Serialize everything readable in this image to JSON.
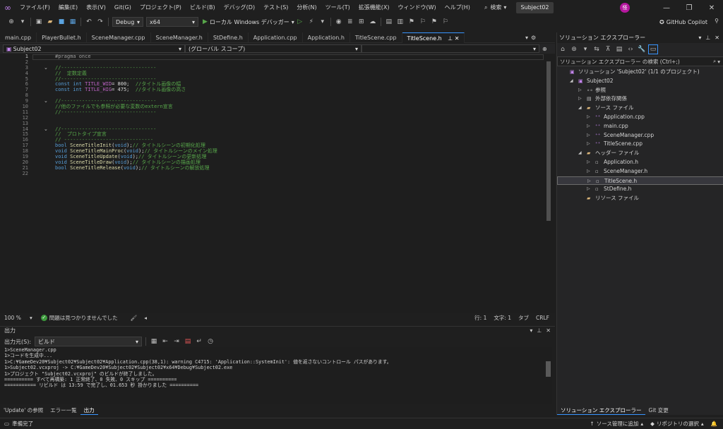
{
  "menu": {
    "items": [
      "ファイル(F)",
      "編集(E)",
      "表示(V)",
      "Git(G)",
      "プロジェクト(P)",
      "ビルド(B)",
      "デバッグ(D)",
      "テスト(S)",
      "分析(N)",
      "ツール(T)",
      "拡張機能(X)",
      "ウィンドウ(W)",
      "ヘルプ(H)"
    ],
    "search_label": "検索",
    "solution_name": "Subject02",
    "avatar_initial": "怪"
  },
  "toolbar": {
    "config": "Debug",
    "platform": "x64",
    "run_label": "ローカル Windows デバッガー",
    "copilot_label": "GitHub Copilot"
  },
  "tabs": [
    {
      "label": "main.cpp",
      "active": false
    },
    {
      "label": "PlayerBullet.h",
      "active": false
    },
    {
      "label": "SceneManager.cpp",
      "active": false
    },
    {
      "label": "SceneManager.h",
      "active": false
    },
    {
      "label": "StDefine.h",
      "active": false
    },
    {
      "label": "Application.cpp",
      "active": false
    },
    {
      "label": "Application.h",
      "active": false
    },
    {
      "label": "TitleScene.cpp",
      "active": false
    },
    {
      "label": "TitleScene.h",
      "active": true
    }
  ],
  "navbar": {
    "project": "Subject02",
    "scope": "(グローバル スコープ)"
  },
  "editor": {
    "line_numbers": [
      "1",
      "2",
      "3",
      "4",
      "5",
      "6",
      "7",
      "8",
      "9",
      "10",
      "11",
      "12",
      "13",
      "14",
      "15",
      "16",
      "17",
      "18",
      "19",
      "20",
      "21",
      "22"
    ],
    "lines": [
      [
        [
          "pp",
          "#pragma once"
        ]
      ],
      [],
      [
        [
          "cm",
          "//--------------------------------"
        ]
      ],
      [
        [
          "cm",
          "//  定数定義"
        ]
      ],
      [
        [
          "cm",
          "//--------------------------------"
        ]
      ],
      [
        [
          "kw",
          "const int "
        ],
        [
          "id",
          "TITLE_WID"
        ],
        [
          "",
          "= 800;  "
        ],
        [
          "cm",
          "//タイトル画像の幅"
        ]
      ],
      [
        [
          "kw",
          "const int "
        ],
        [
          "id",
          "TITLE_HIG"
        ],
        [
          "",
          "= 475;  "
        ],
        [
          "cm",
          "//タイトル画像の高さ"
        ]
      ],
      [],
      [
        [
          "cm",
          "//--------------------------------"
        ]
      ],
      [
        [
          "cm",
          "//他のファイルでも参照が必要な変数のextern宣言"
        ]
      ],
      [
        [
          "cm",
          "//--------------------------------"
        ]
      ],
      [],
      [],
      [
        [
          "cm",
          "//--------------------------------"
        ]
      ],
      [
        [
          "cm",
          "//  プロトタイプ宣言"
        ]
      ],
      [
        [
          "cm",
          "// ------------------------------"
        ]
      ],
      [
        [
          "kw",
          "bool "
        ],
        [
          "fn",
          "SceneTitleInit"
        ],
        [
          "",
          "("
        ],
        [
          "kw",
          "void"
        ],
        [
          "",
          ");"
        ],
        [
          "cm",
          "// タイトルシーンの初期化処理"
        ]
      ],
      [
        [
          "kw",
          "void "
        ],
        [
          "fn",
          "SceneTitleMainProc"
        ],
        [
          "",
          "("
        ],
        [
          "kw",
          "void"
        ],
        [
          "",
          ");"
        ],
        [
          "cm",
          "// タイトルシーンのメイン処理"
        ]
      ],
      [
        [
          "kw",
          "void "
        ],
        [
          "fn",
          "SceneTitleUpdate"
        ],
        [
          "",
          "("
        ],
        [
          "kw",
          "void"
        ],
        [
          "",
          ");"
        ],
        [
          "cm",
          "// タイトルシーンの更新処理"
        ]
      ],
      [
        [
          "kw",
          "void "
        ],
        [
          "fn",
          "SceneTitleDraw"
        ],
        [
          "",
          "("
        ],
        [
          "kw",
          "void"
        ],
        [
          "",
          ");"
        ],
        [
          "cm",
          "// タイトルシーンの描画処理"
        ]
      ],
      [
        [
          "kw",
          "bool "
        ],
        [
          "fn",
          "SceneTitleRelease"
        ],
        [
          "",
          "("
        ],
        [
          "kw",
          "void"
        ],
        [
          "",
          ");"
        ],
        [
          "cm",
          "// タイトルシーンの解放処理"
        ]
      ],
      []
    ]
  },
  "editor_status": {
    "zoom": "100 %",
    "issues": "問題は見つかりませんでした",
    "line": "行: 1",
    "char": "文字: 1",
    "tab": "タブ",
    "eol": "CRLF"
  },
  "output": {
    "title": "出力",
    "source_label": "出力元(S):",
    "source_value": "ビルド",
    "lines": [
      "1>SceneManager.cpp",
      "1>コードを生成中...",
      "1>C:¥GameDev20¥Subject02¥Subject02¥Application.cpp(38,1): warning C4715: 'Application::SystemInit': 値を返さないコントロール パスがあります。",
      "1>Subject02.vcxproj -> C:¥GameDev20¥Subject02¥Subject02¥x64¥Debug¥Subject02.exe",
      "1>プロジェクト \"Subject02.vcxproj\" のビルドが終了しました。",
      "========== すべて再構築: 1 正常終了、0 失敗、0 スキップ ==========",
      "=========== リビルド は 13:59 で完了し、01.653 秒 掛かりました =========="
    ]
  },
  "bottom_tabs": [
    "'Update' の参照",
    "エラー一覧",
    "出力"
  ],
  "solution_explorer": {
    "title": "ソリューション エクスプローラー",
    "search_placeholder": "ソリューション エクスプローラー の検索 (Ctrl+;)",
    "tree": [
      {
        "label": "ソリューション 'Subject02' (1/1 のプロジェクト)",
        "depth": 0,
        "arrow": "",
        "icon": "solution-icon"
      },
      {
        "label": "Subject02",
        "depth": 1,
        "arrow": "▲",
        "icon": "project-icon"
      },
      {
        "label": "参照",
        "depth": 2,
        "arrow": "▷",
        "icon": "references-icon"
      },
      {
        "label": "外部依存関係",
        "depth": 2,
        "arrow": "▷",
        "icon": "dependencies-icon"
      },
      {
        "label": "ソース ファイル",
        "depth": 2,
        "arrow": "▲",
        "icon": "folder-icon"
      },
      {
        "label": "Application.cpp",
        "depth": 3,
        "arrow": "▷",
        "icon": "cpp-file-icon"
      },
      {
        "label": "main.cpp",
        "depth": 3,
        "arrow": "▷",
        "icon": "cpp-file-icon"
      },
      {
        "label": "SceneManager.cpp",
        "depth": 3,
        "arrow": "▷",
        "icon": "cpp-file-icon"
      },
      {
        "label": "TitleScene.cpp",
        "depth": 3,
        "arrow": "▷",
        "icon": "cpp-file-icon"
      },
      {
        "label": "ヘッダー ファイル",
        "depth": 2,
        "arrow": "▲",
        "icon": "folder-icon"
      },
      {
        "label": "Application.h",
        "depth": 3,
        "arrow": "▷",
        "icon": "header-file-icon"
      },
      {
        "label": "SceneManager.h",
        "depth": 3,
        "arrow": "▷",
        "icon": "header-file-icon"
      },
      {
        "label": "TitleScene.h",
        "depth": 3,
        "arrow": "▷",
        "icon": "header-file-icon",
        "selected": true
      },
      {
        "label": "StDefine.h",
        "depth": 3,
        "arrow": "▷",
        "icon": "header-file-icon"
      },
      {
        "label": "リソース ファイル",
        "depth": 2,
        "arrow": "",
        "icon": "folder-icon"
      }
    ],
    "bottom_tabs": [
      "ソリューション エクスプローラー",
      "Git 変更"
    ]
  },
  "statusbar": {
    "ready": "準備完了",
    "source_control": "ソース管理に追加",
    "repo": "リポジトリの選択"
  },
  "colors": {
    "accent": "#3794ff",
    "keyword": "#569cd6",
    "comment": "#57a64a",
    "function": "#dcdcaa",
    "macro": "#bd63c5"
  }
}
